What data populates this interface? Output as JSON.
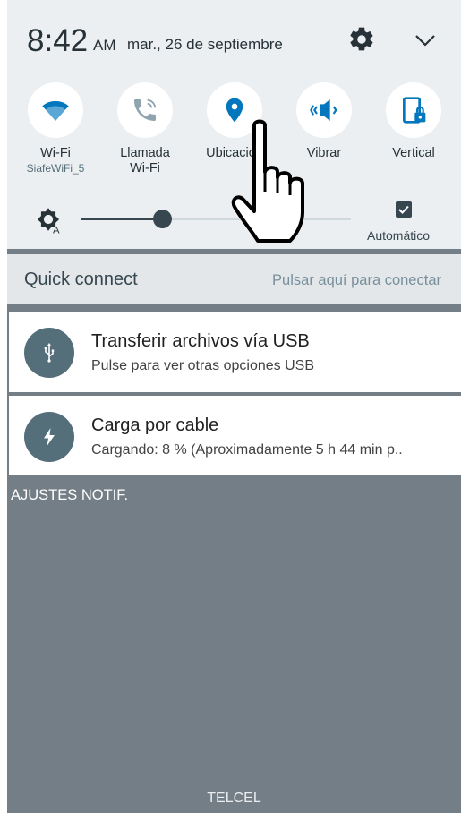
{
  "status": {
    "time": "8:42",
    "ampm": "AM",
    "date": "mar., 26 de septiembre"
  },
  "tiles": [
    {
      "label": "Wi-Fi",
      "sub": "SiafeWiFi_5",
      "icon": "wifi-icon",
      "active": true
    },
    {
      "label": "Llamada Wi-Fi",
      "sub": "",
      "icon": "wifi-call-icon",
      "active": false
    },
    {
      "label": "Ubicación",
      "sub": "",
      "icon": "location-icon",
      "active": true
    },
    {
      "label": "Vibrar",
      "sub": "",
      "icon": "vibrate-icon",
      "active": true
    },
    {
      "label": "Vertical",
      "sub": "",
      "icon": "portrait-lock-icon",
      "active": true
    }
  ],
  "brightness": {
    "level": 0.3,
    "auto_label": "Automático",
    "auto_checked": true
  },
  "quick_connect": {
    "title": "Quick connect",
    "action": "Pulsar aquí para conectar"
  },
  "notifications": [
    {
      "icon": "usb-icon",
      "title": "Transferir archivos vía USB",
      "text": "Pulse para ver otras opciones USB"
    },
    {
      "icon": "charging-icon",
      "title": "Carga por cable",
      "text": "Cargando: 8 % (Aproximadamente 5 h 44 min p.."
    }
  ],
  "settings_label": "AJUSTES NOTIF.",
  "carrier": "TELCEL",
  "colors": {
    "accent": "#0277bd",
    "inactive_icon": "#90a4ae",
    "panel_bg": "#eceff1",
    "shade_bg": "#737e86"
  }
}
